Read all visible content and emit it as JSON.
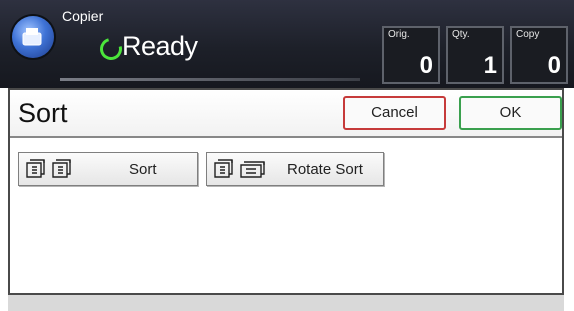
{
  "header": {
    "app_label": "Copier",
    "status": "Ready",
    "counters": [
      {
        "label": "Orig.",
        "value": "0"
      },
      {
        "label": "Qty.",
        "value": "1"
      },
      {
        "label": "Copy",
        "value": "0"
      }
    ]
  },
  "dialog": {
    "title": "Sort",
    "cancel_label": "Cancel",
    "ok_label": "OK",
    "options": [
      {
        "label": "Sort",
        "icon": "sort-icon"
      },
      {
        "label": "Rotate Sort",
        "icon": "rotate-sort-icon"
      }
    ]
  },
  "colors": {
    "header_bg": "#1d2029",
    "ready_icon": "#4be53b",
    "cancel_border": "#c63a3a",
    "ok_border": "#3aa04e"
  }
}
